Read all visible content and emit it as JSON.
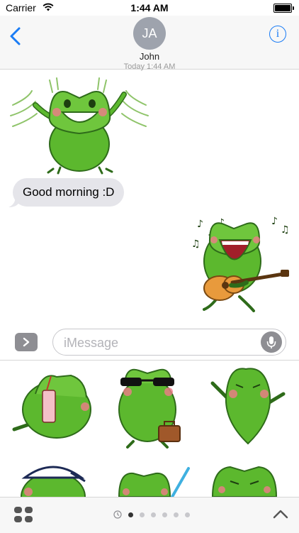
{
  "status_bar": {
    "carrier": "Carrier",
    "time": "1:44 AM"
  },
  "nav": {
    "avatar_initials": "JA",
    "contact_name": "John",
    "back_icon": "chevron-left-icon",
    "info_icon": "info-icon"
  },
  "conversation": {
    "timestamp": "Today 1:44 AM",
    "received_text": "Good morning :D"
  },
  "input": {
    "placeholder": "iMessage"
  },
  "drawer": {
    "sticker_count_visible": 6,
    "page_dots": 6
  },
  "colors": {
    "accent": "#1a7cf5",
    "frog_green": "#5cb82e",
    "bubble_gray": "#e5e5ea"
  }
}
